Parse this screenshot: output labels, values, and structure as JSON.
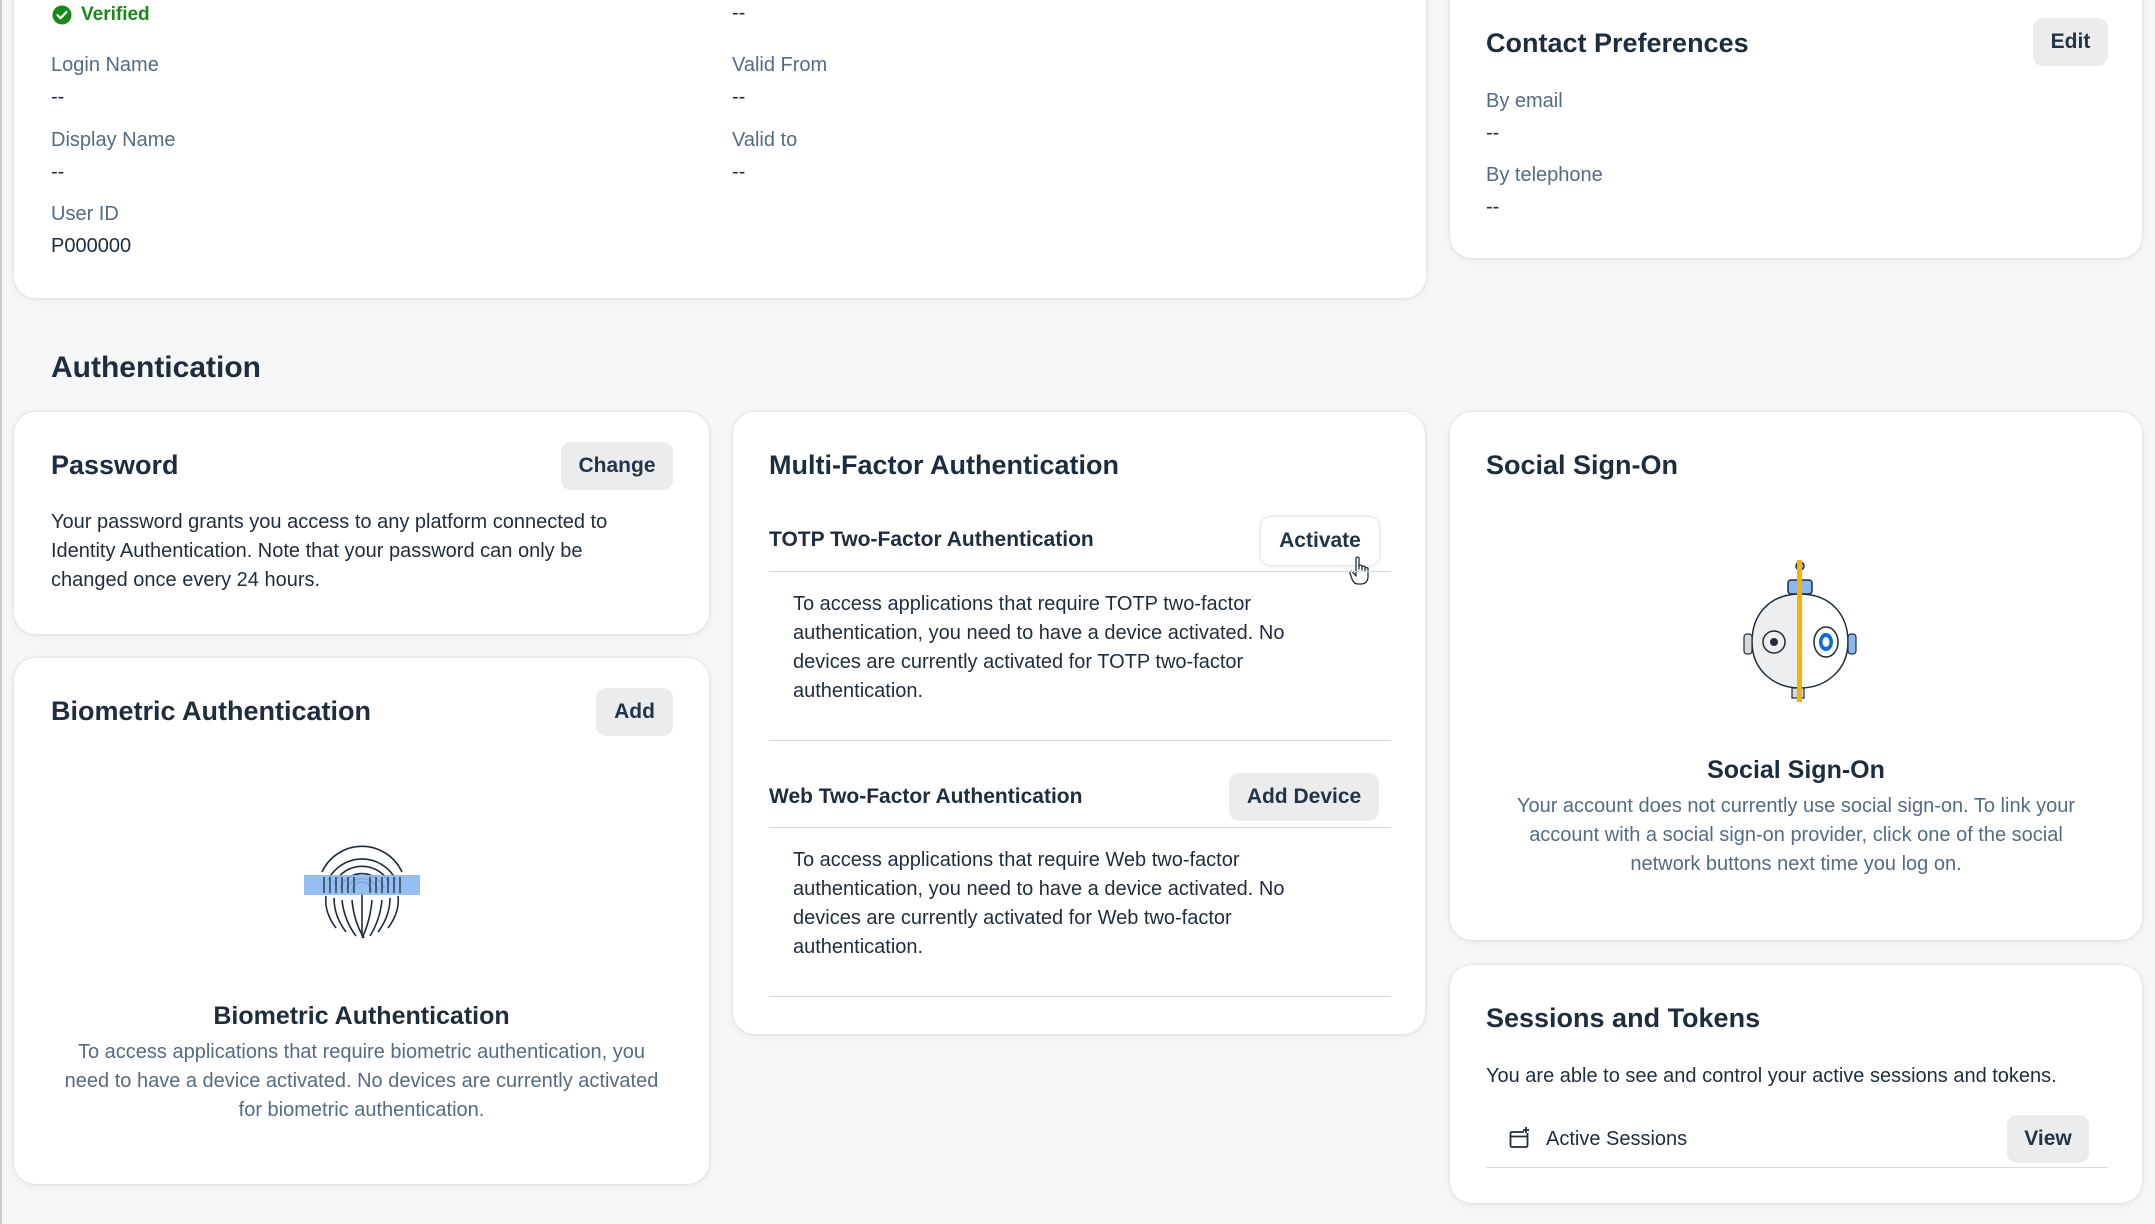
{
  "profile": {
    "verified_label": "Verified",
    "top_value": "--",
    "login_name_label": "Login Name",
    "login_name_value": "--",
    "valid_from_label": "Valid From",
    "valid_from_value": "--",
    "display_name_label": "Display Name",
    "display_name_value": "--",
    "valid_to_label": "Valid to",
    "valid_to_value": "--",
    "user_id_label": "User ID",
    "user_id_value": "P000000"
  },
  "contact": {
    "title": "Contact Preferences",
    "edit_label": "Edit",
    "email_label": "By email",
    "email_value": "--",
    "telephone_label": "By telephone",
    "telephone_value": "--"
  },
  "section_title": "Authentication",
  "password": {
    "title": "Password",
    "change_label": "Change",
    "description": "Your password grants you access to any platform connected to Identity Authentication. Note that your password can only be changed once every 24 hours."
  },
  "biometric": {
    "title": "Biometric Authentication",
    "add_label": "Add",
    "empty_title": "Biometric Authentication",
    "empty_text": "To access applications that require biometric authentication, you need to have a device activated. No devices are currently activated for biometric authentication."
  },
  "mfa": {
    "title": "Multi-Factor Authentication",
    "totp_title": "TOTP Two-Factor Authentication",
    "totp_button": "Activate",
    "totp_text": "To access applications that require TOTP two-factor authentication, you need to have a device activated. No devices are currently activated for TOTP two-factor authentication.",
    "web_title": "Web Two-Factor Authentication",
    "web_button": "Add Device",
    "web_text": "To access applications that require Web two-factor authentication, you need to have a device activated. No devices are currently activated for Web two-factor authentication."
  },
  "social": {
    "title": "Social Sign-On",
    "empty_title": "Social Sign-On",
    "empty_text": "Your account does not currently use social sign-on. To link your account with a social sign-on provider, click one of the social network buttons next time you log on."
  },
  "sessions": {
    "title": "Sessions and Tokens",
    "description": "You are able to see and control your active sessions and tokens.",
    "active_sessions_label": "Active Sessions",
    "view_label": "View"
  },
  "colors": {
    "accent": "#0a6ed1",
    "success": "#188918",
    "text": "#1d2d3e",
    "label": "#556b82",
    "background": "#f5f6f7"
  }
}
